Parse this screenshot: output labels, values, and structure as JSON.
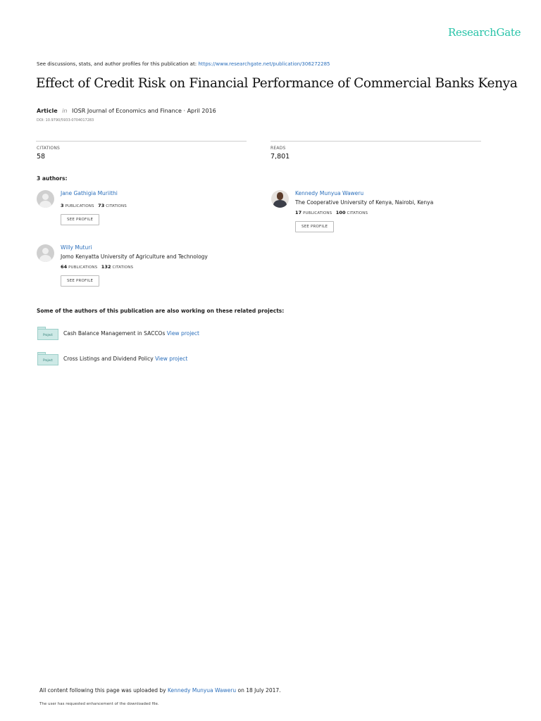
{
  "brand": {
    "logo_text": "ResearchGate",
    "logo_color": "#28c3a8",
    "link_color": "#2a6ebb"
  },
  "header": {
    "discussion_text": "See discussions, stats, and author profiles for this publication at:",
    "publication_url": "https://www.researchgate.net/publication/306272285"
  },
  "paper": {
    "title": "Effect of Credit Risk on Financial Performance of Commercial Banks Kenya",
    "type": "Article",
    "in_word": "in",
    "venue": "IOSR Journal of Economics and Finance · April 2016",
    "doi": "DOI: 10.9790/5933-0704017283"
  },
  "stats": {
    "citations_label": "CITATIONS",
    "citations_value": "58",
    "reads_label": "READS",
    "reads_value": "7,801"
  },
  "authors_heading": "3 authors:",
  "authors": [
    {
      "name": "Jane Gathigia Muriithi",
      "institution": "",
      "publications": "3",
      "citations": "73",
      "avatar": "default-avatar-icon"
    },
    {
      "name": "Kennedy Munyua Waweru",
      "institution": "The Cooperative University of Kenya, Nairobi, Kenya",
      "publications": "17",
      "citations": "100",
      "avatar": "profile-photo"
    },
    {
      "name": "Willy Muturi",
      "institution": "Jomo Kenyatta University of Agriculture and Technology",
      "publications": "64",
      "citations": "132",
      "avatar": "default-avatar-icon"
    }
  ],
  "labels": {
    "publications": "PUBLICATIONS",
    "citations": "CITATIONS",
    "see_profile": "SEE PROFILE",
    "view_project": "View project",
    "project_icon_text": "Project"
  },
  "projects_heading": "Some of the authors of this publication are also working on these related projects:",
  "projects": [
    {
      "name": "Cash Balance Management in SACCOs"
    },
    {
      "name": "Cross Listings and Dividend Policy"
    }
  ],
  "footer": {
    "uploaded_prefix": "All content following this page was uploaded by",
    "uploader": "Kennedy Munyua Waweru",
    "uploaded_suffix": "on 18 July 2017.",
    "note": "The user has requested enhancement of the downloaded file."
  }
}
